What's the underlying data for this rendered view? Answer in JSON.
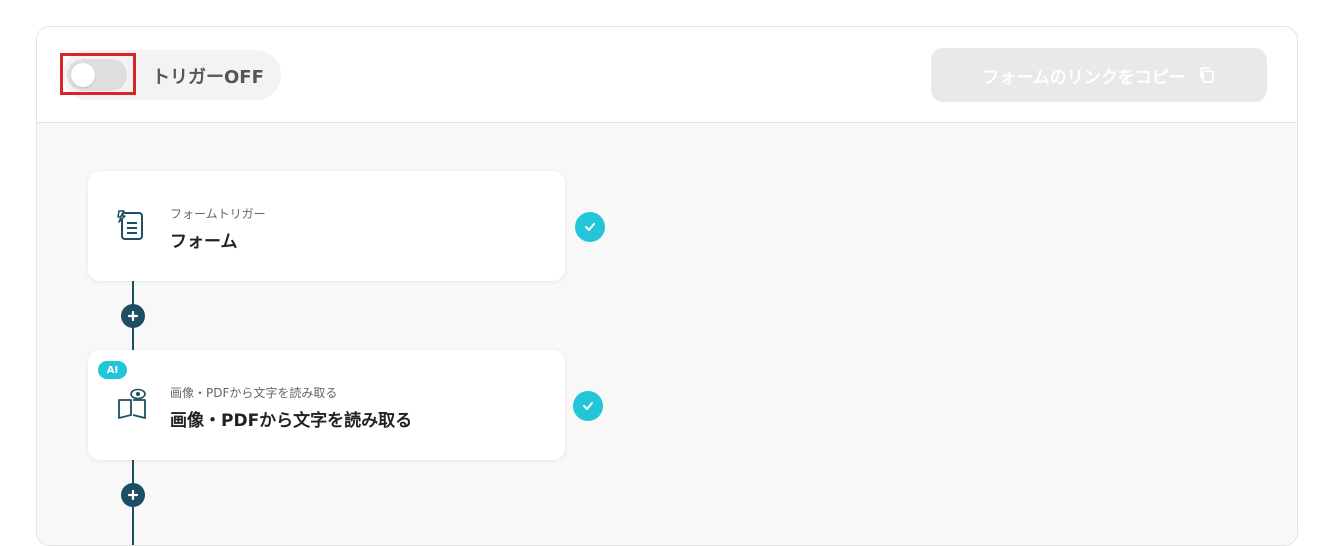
{
  "header": {
    "toggle_label": "トリガーOFF",
    "toggle_state": "off",
    "copy_link_label": "フォームのリンクをコピー"
  },
  "steps": [
    {
      "subtitle": "フォームトリガー",
      "title": "フォーム",
      "icon": "form-trigger-icon",
      "completed": true
    },
    {
      "badge": "AI",
      "subtitle": "画像・PDFから文字を読み取る",
      "title": "画像・PDFから文字を読み取る",
      "icon": "book-eye-icon",
      "completed": true
    }
  ],
  "colors": {
    "accent_teal": "#23c6d9",
    "flow_line": "#1d4e63",
    "highlight_red": "#d7262a"
  }
}
